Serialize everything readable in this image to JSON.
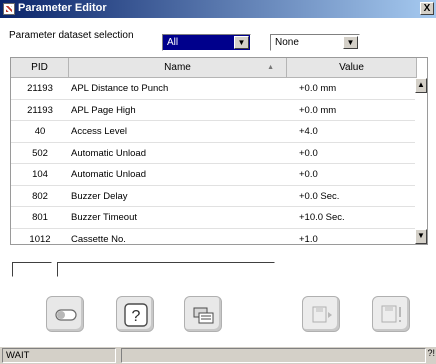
{
  "window": {
    "title": "Parameter Editor",
    "close_label": "X"
  },
  "selection": {
    "label": "Parameter dataset selection",
    "dataset_value": "All",
    "filter_value": "None"
  },
  "table": {
    "columns": [
      "PID",
      "Name",
      "Value"
    ],
    "rows": [
      {
        "pid": "21193",
        "name": "APL Distance to Punch",
        "value": "+0.0 mm"
      },
      {
        "pid": "21193",
        "name": "APL Page High",
        "value": "+0.0 mm"
      },
      {
        "pid": "40",
        "name": "Access Level",
        "value": "+4.0"
      },
      {
        "pid": "502",
        "name": "Automatic Unload",
        "value": "+0.0"
      },
      {
        "pid": "104",
        "name": "Automatic Unload",
        "value": "+0.0"
      },
      {
        "pid": "802",
        "name": "Buzzer Delay",
        "value": "+0.0 Sec."
      },
      {
        "pid": "801",
        "name": "Buzzer Timeout",
        "value": "+10.0 Sec."
      },
      {
        "pid": "1012",
        "name": "Cassette No.",
        "value": "+1.0"
      }
    ]
  },
  "toolbar": {
    "icons": [
      "toggle-icon",
      "help-icon",
      "device-settings-icon",
      "save-forward-icon",
      "save-alert-icon"
    ]
  },
  "status": {
    "text": "WAIT",
    "help": "?!"
  }
}
